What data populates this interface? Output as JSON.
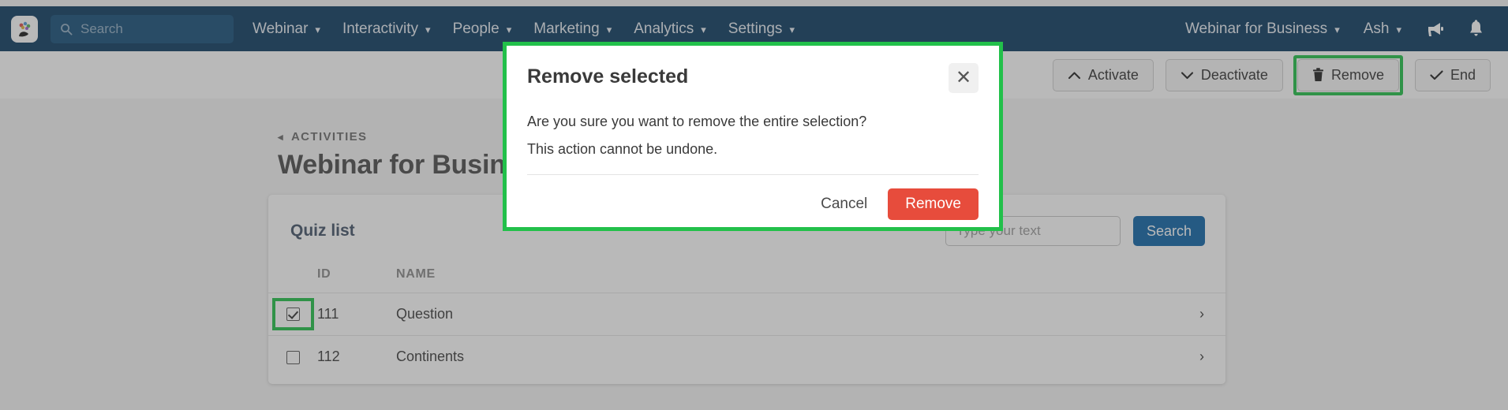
{
  "navbar": {
    "logo_icon": "app-logo-icon",
    "search": {
      "placeholder": "Search",
      "icon": "search-icon"
    },
    "items": [
      {
        "label": "Webinar",
        "caret": "▾"
      },
      {
        "label": "Interactivity",
        "caret": "▾"
      },
      {
        "label": "People",
        "caret": "▾"
      },
      {
        "label": "Marketing",
        "caret": "▾"
      },
      {
        "label": "Analytics",
        "caret": "▾"
      },
      {
        "label": "Settings",
        "caret": "▾"
      }
    ],
    "right_items": [
      {
        "label": "Webinar for Business",
        "caret": "▾"
      },
      {
        "label": "Ash",
        "caret": "▾"
      }
    ],
    "announcement_icon": "megaphone-icon",
    "notifications_icon": "bell-icon",
    "background": "#0d3c61"
  },
  "toolbar": {
    "buttons": [
      {
        "label": "Activate",
        "icon": "chevron-up-icon",
        "glyph": "∧",
        "highlighted": false
      },
      {
        "label": "Deactivate",
        "icon": "chevron-down-icon",
        "glyph": "∨",
        "highlighted": false
      },
      {
        "label": "Remove",
        "icon": "trash-icon",
        "glyph": "",
        "highlighted": true
      },
      {
        "label": "End",
        "icon": "check-icon",
        "glyph": "✔",
        "highlighted": false
      }
    ],
    "highlight_color": "#22c04a"
  },
  "page": {
    "breadcrumb": {
      "label": "ACTIVITIES",
      "back_glyph": "◂"
    },
    "title": "Webinar for Business"
  },
  "card": {
    "title": "Quiz list",
    "search": {
      "placeholder": "Type your text",
      "value": ""
    },
    "search_button": "Search",
    "search_button_color": "#1166a8",
    "columns": [
      "",
      "ID",
      "NAME",
      ""
    ],
    "rows": [
      {
        "checked": true,
        "id": "111",
        "name": "Question",
        "arrow": "›",
        "highlighted": true
      },
      {
        "checked": false,
        "id": "112",
        "name": "Continents",
        "arrow": "›",
        "highlighted": false
      }
    ]
  },
  "modal": {
    "title": "Remove selected",
    "close_icon": "close-icon",
    "close_glyph": "✕",
    "body_line1": "Are you sure you want to remove the entire selection?",
    "body_line2": "This action cannot be undone.",
    "cancel_label": "Cancel",
    "confirm_label": "Remove",
    "confirm_color": "#e74c3c",
    "outline_color": "#22c04a"
  }
}
